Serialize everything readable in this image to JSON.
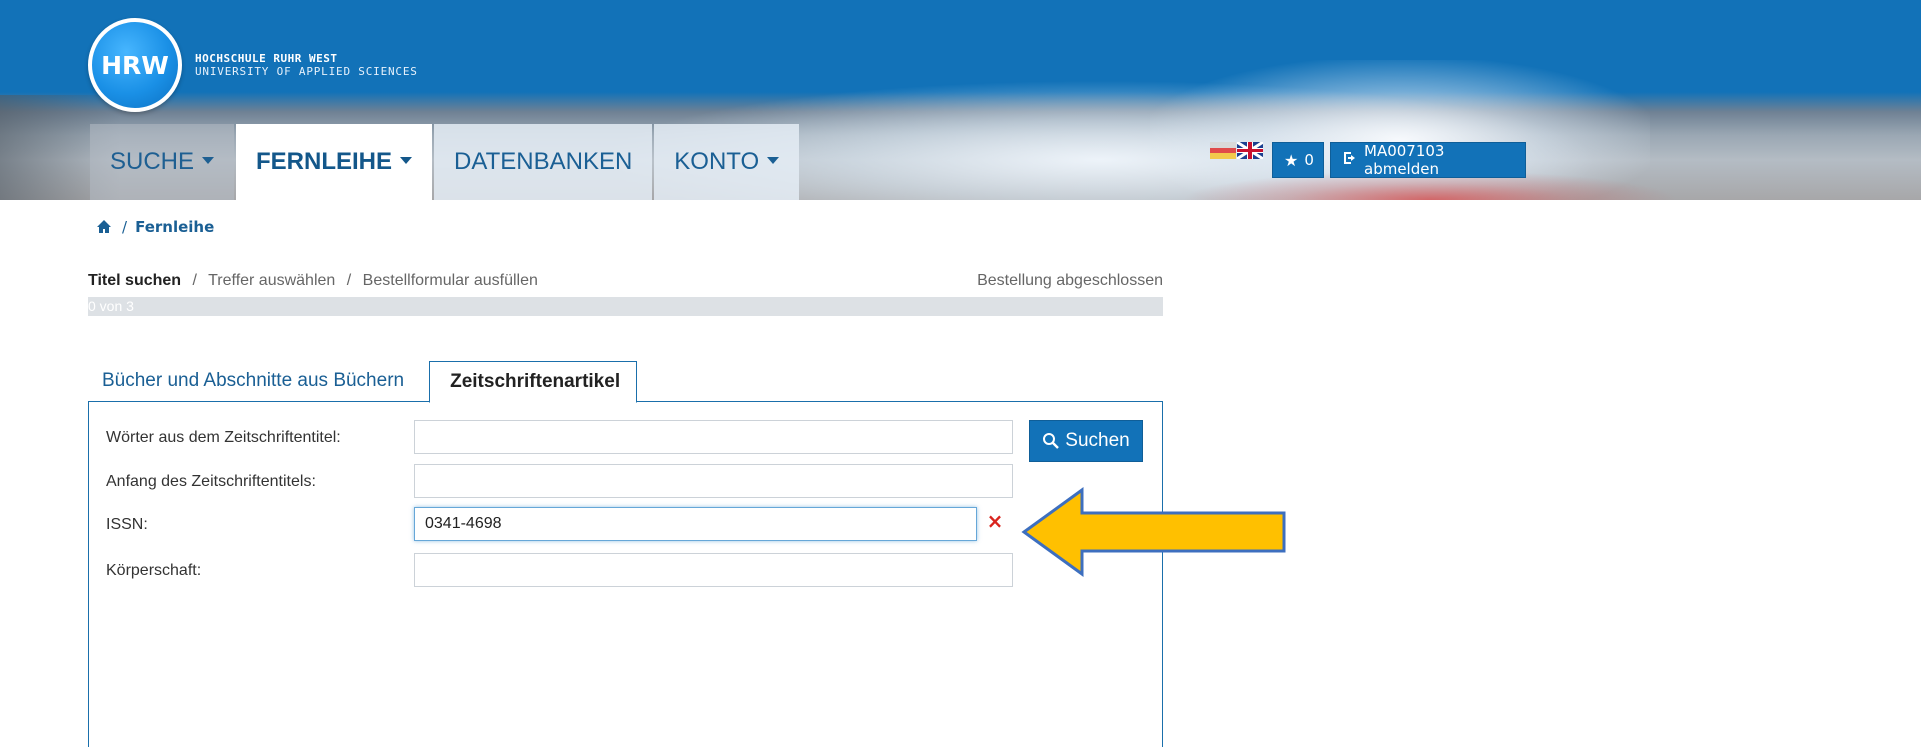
{
  "header": {
    "logo_text": "HRW",
    "org_line1": "HOCHSCHULE RUHR WEST",
    "org_line2": "UNIVERSITY OF APPLIED SCIENCES"
  },
  "nav": {
    "items": [
      {
        "label": "SUCHE",
        "dropdown": true
      },
      {
        "label": "FERNLEIHE",
        "dropdown": true,
        "active": true
      },
      {
        "label": "DATENBANKEN",
        "dropdown": false
      },
      {
        "label": "KONTO",
        "dropdown": true
      }
    ]
  },
  "toolbar": {
    "favorites_count": "0",
    "logout_label": "MA007103 abmelden"
  },
  "breadcrumb": {
    "current": "Fernleihe",
    "separator": "/"
  },
  "steps": {
    "items": [
      "Titel suchen",
      "Treffer auswählen",
      "Bestellformular ausfüllen"
    ],
    "separator": "/",
    "final": "Bestellung abgeschlossen",
    "progress_text": "0 von 3",
    "progress_fraction": 0
  },
  "tabs": {
    "items": [
      "Bücher und Abschnitte aus Büchern",
      "Zeitschriftenartikel"
    ],
    "active_index": 1
  },
  "form": {
    "fields": [
      {
        "label": "Wörter aus dem Zeitschriftentitel:",
        "value": ""
      },
      {
        "label": "Anfang des Zeitschriftentitels:",
        "value": ""
      },
      {
        "label": "ISSN:",
        "value": "0341-4698"
      },
      {
        "label": "Körperschaft:",
        "value": ""
      }
    ],
    "search_label": "Suchen",
    "clear_symbol": "×"
  },
  "colors": {
    "brand_blue": "#1272b8",
    "link_blue": "#1a5f94",
    "clear_red": "#d9241e",
    "arrow_fill": "#ffc000",
    "arrow_stroke": "#3d6fbf"
  }
}
